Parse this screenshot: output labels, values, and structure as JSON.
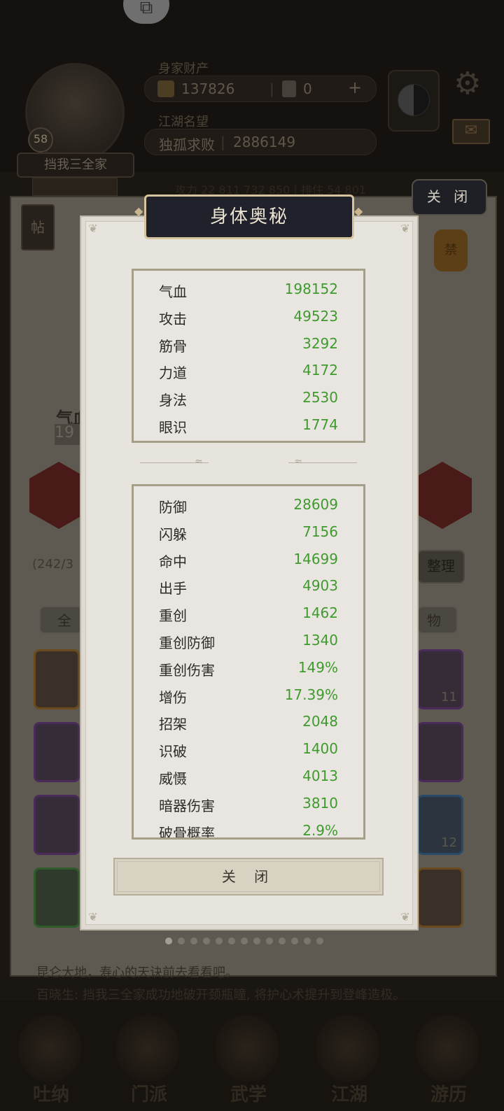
{
  "header": {
    "wealth_title": "身家财产",
    "gold": "137826",
    "gems": "0",
    "fame_title": "江湖名望",
    "fame_rank": "独孤求败",
    "fame_value": "2886149",
    "player_name": "挡我三全家",
    "level": "58",
    "power_line": "攻力 22 811 732 850 | 排住 54 801"
  },
  "top_close_label": "关 闭",
  "post_label": "帖",
  "seal_label": "禁",
  "inventory": {
    "count": "(242/3",
    "arrange_label": "整理",
    "tab_all": "全",
    "tab_items": "物",
    "slot_counts": [
      "11",
      "12"
    ]
  },
  "left_stat": {
    "label": "气血",
    "value": "19"
  },
  "chat": {
    "line1": "昆仑大地，寿心的天诀前去看看吧。",
    "line2": "百晓生: 挡我三全家成功地破开颈瓶瞳, 将护心术提升到登峰造极。"
  },
  "bottom_tabs": [
    "吐纳",
    "门派",
    "武学",
    "江湖",
    "游历"
  ],
  "modal": {
    "title": "身体奥秘",
    "close_label": "关 闭",
    "panel1": [
      {
        "name": "气血",
        "value": "198152"
      },
      {
        "name": "攻击",
        "value": "49523"
      },
      {
        "name": "筋骨",
        "value": "3292"
      },
      {
        "name": "力道",
        "value": "4172"
      },
      {
        "name": "身法",
        "value": "2530"
      },
      {
        "name": "眼识",
        "value": "1774"
      }
    ],
    "panel2": [
      {
        "name": "防御",
        "value": "28609"
      },
      {
        "name": "闪躲",
        "value": "7156"
      },
      {
        "name": "命中",
        "value": "14699"
      },
      {
        "name": "出手",
        "value": "4903"
      },
      {
        "name": "重创",
        "value": "1462"
      },
      {
        "name": "重创防御",
        "value": "1340"
      },
      {
        "name": "重创伤害",
        "value": "149%"
      },
      {
        "name": "增伤",
        "value": "17.39%"
      },
      {
        "name": "招架",
        "value": "2048"
      },
      {
        "name": "识破",
        "value": "1400"
      },
      {
        "name": "威慑",
        "value": "4013"
      },
      {
        "name": "暗器伤害",
        "value": "3810"
      },
      {
        "name": "破骨概率",
        "value": "2.9%"
      }
    ]
  },
  "colors": {
    "stat_value": "#3f9a2e",
    "title_bg": "#20212a",
    "panel_border": "#a59e88"
  }
}
